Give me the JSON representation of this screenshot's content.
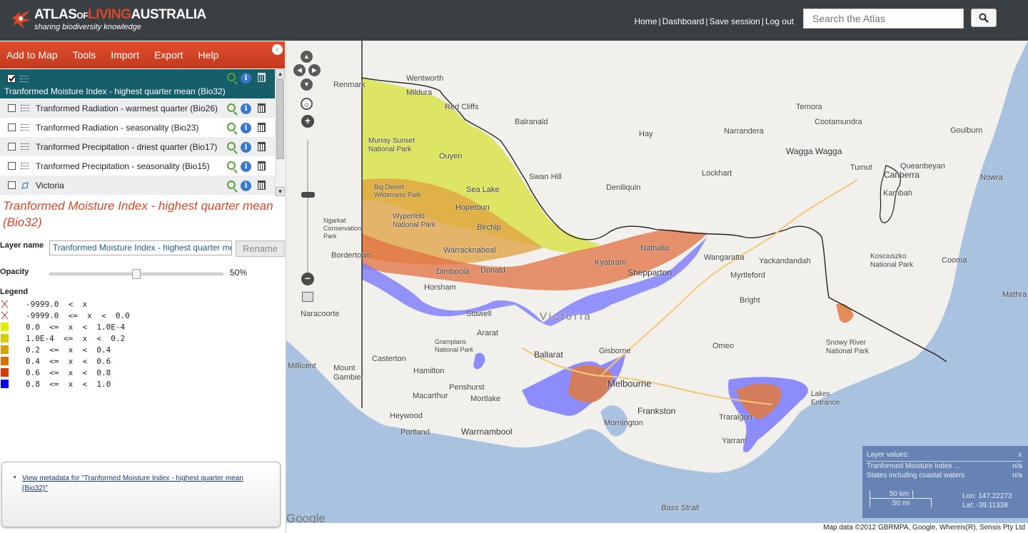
{
  "header": {
    "logo_word1": "ATLAS",
    "logo_word_of": "OF",
    "logo_word2": "LIVING",
    "logo_word3": "AUSTRALIA",
    "tagline": "sharing biodiversity knowledge",
    "links": [
      "Home",
      "Dashboard",
      "Save session",
      "Log out"
    ],
    "search_placeholder": "Search the Atlas",
    "search_icon": "magnifier-icon"
  },
  "menu": {
    "items": [
      "Add to Map",
      "Tools",
      "Import",
      "Export",
      "Help"
    ],
    "collapse_icon": "chevron-left-icon"
  },
  "layers": [
    {
      "name": "Tranformed Moisture Index - highest quarter mean (Bio32)",
      "checked": true,
      "selected": true,
      "type": "environmental"
    },
    {
      "name": "Tranformed Radiation - warmest quarter (Bio26)",
      "checked": false,
      "type": "environmental"
    },
    {
      "name": "Tranformed Radiation - seasonality (Bio23)",
      "checked": false,
      "type": "environmental"
    },
    {
      "name": "Tranformed Precipitation - driest quarter (Bio17)",
      "checked": false,
      "type": "environmental"
    },
    {
      "name": "Tranformed Precipitation - seasonality (Bio15)",
      "checked": false,
      "type": "environmental"
    },
    {
      "name": "Victoria",
      "checked": false,
      "type": "area"
    }
  ],
  "details": {
    "title": "Tranformed Moisture Index - highest quarter mean (Bio32)",
    "layer_name_label": "Layer name",
    "layer_name_value": "Tranformed Moisture Index - highest quarter mean (Bio32)",
    "rename_label": "Rename",
    "opacity_label": "Opacity",
    "opacity_value": "50%",
    "opacity_fraction": 0.5,
    "legend_label": "Legend",
    "legend": [
      {
        "text": "-9999.0  <  x",
        "color": "none"
      },
      {
        "text": "-9999.0  <=  x  <  0.0",
        "color": "none"
      },
      {
        "text": "0.0  <=  x  <  1.0E-4",
        "color": "#ddee00"
      },
      {
        "text": "1.0E-4  <=  x  <  0.2",
        "color": "#d8cc00"
      },
      {
        "text": "0.2  <=  x  <  0.4",
        "color": "#d8a000"
      },
      {
        "text": "0.4  <=  x  <  0.6",
        "color": "#d87000"
      },
      {
        "text": "0.6  <=  x  <  0.8",
        "color": "#d83a00"
      },
      {
        "text": "0.8  <=  x  <  1.0",
        "color": "#0000ee"
      }
    ],
    "metadata_link": "View metadata for \"Tranformed Moisture Index - highest quarter mean (Bio32)\""
  },
  "map": {
    "places": [
      {
        "name": "Wentworth"
      },
      {
        "name": "Mildura"
      },
      {
        "name": "Red Cliffs"
      },
      {
        "name": "Balranald"
      },
      {
        "name": "Hay"
      },
      {
        "name": "Narrandera"
      },
      {
        "name": "Temora"
      },
      {
        "name": "Cootamundra"
      },
      {
        "name": "Wagga Wagga"
      },
      {
        "name": "Goulburn"
      },
      {
        "name": "Tumut"
      },
      {
        "name": "Canberra"
      },
      {
        "name": "Queanbeyan"
      },
      {
        "name": "Nowra"
      },
      {
        "name": "Murray Sunset National Park"
      },
      {
        "name": "Ouyen"
      },
      {
        "name": "Swan Hill"
      },
      {
        "name": "Sea Lake"
      },
      {
        "name": "Deniliquin"
      },
      {
        "name": "Lockhart"
      },
      {
        "name": "Big Desert Wilderness Park"
      },
      {
        "name": "Hopetoun"
      },
      {
        "name": "Wyperfeld National Park"
      },
      {
        "name": "Birchip"
      },
      {
        "name": "Ngarkat Conservation Park"
      },
      {
        "name": "Bordertown"
      },
      {
        "name": "Warracknabeal"
      },
      {
        "name": "Nathalia"
      },
      {
        "name": "Wangaratta"
      },
      {
        "name": "Dimboola"
      },
      {
        "name": "Donald"
      },
      {
        "name": "Kyabram"
      },
      {
        "name": "Shepparton"
      },
      {
        "name": "Yackandandah"
      },
      {
        "name": "Kosciuszko National Park"
      },
      {
        "name": "Cooma"
      },
      {
        "name": "Horsham"
      },
      {
        "name": "Myrtleford"
      },
      {
        "name": "Bright"
      },
      {
        "name": "Naracoorte"
      },
      {
        "name": "Stawell"
      },
      {
        "name": "Victoria"
      },
      {
        "name": "Ararat"
      },
      {
        "name": "Grampians National Park"
      },
      {
        "name": "Ballarat"
      },
      {
        "name": "Omeo"
      },
      {
        "name": "Mount Gambier"
      },
      {
        "name": "Casterton"
      },
      {
        "name": "Hamilton"
      },
      {
        "name": "Gisborne"
      },
      {
        "name": "Melbourne"
      },
      {
        "name": "Snowy River National Park"
      },
      {
        "name": "Penshurst"
      },
      {
        "name": "Mortlake"
      },
      {
        "name": "Macarthur"
      },
      {
        "name": "Frankston"
      },
      {
        "name": "Lakes Entrance"
      },
      {
        "name": "Heywood"
      },
      {
        "name": "Warrnambool"
      },
      {
        "name": "Portland"
      },
      {
        "name": "Mornington"
      },
      {
        "name": "Traralgon"
      },
      {
        "name": "Yarram"
      },
      {
        "name": "Bass Strait"
      },
      {
        "name": "Millicent"
      },
      {
        "name": "Renmark"
      },
      {
        "name": "Mathra"
      },
      {
        "name": "Kambah"
      }
    ],
    "layer_values": {
      "title": "Layer values:",
      "close": "x",
      "rows": [
        {
          "label": "Tranformed Moisture Index ...",
          "value": "n/a"
        },
        {
          "label": "States including coastal waters",
          "value": "n/a"
        }
      ],
      "scale_km": "50 km",
      "scale_mi": "50 mi",
      "lon": "Lon: 147.22273",
      "lat": "Lat: -39.11338"
    },
    "google_logo": "Google",
    "attribution": "Map data ©2012 GBRMPA, Google, Whereis(R), Sensis Pty Ltd"
  }
}
